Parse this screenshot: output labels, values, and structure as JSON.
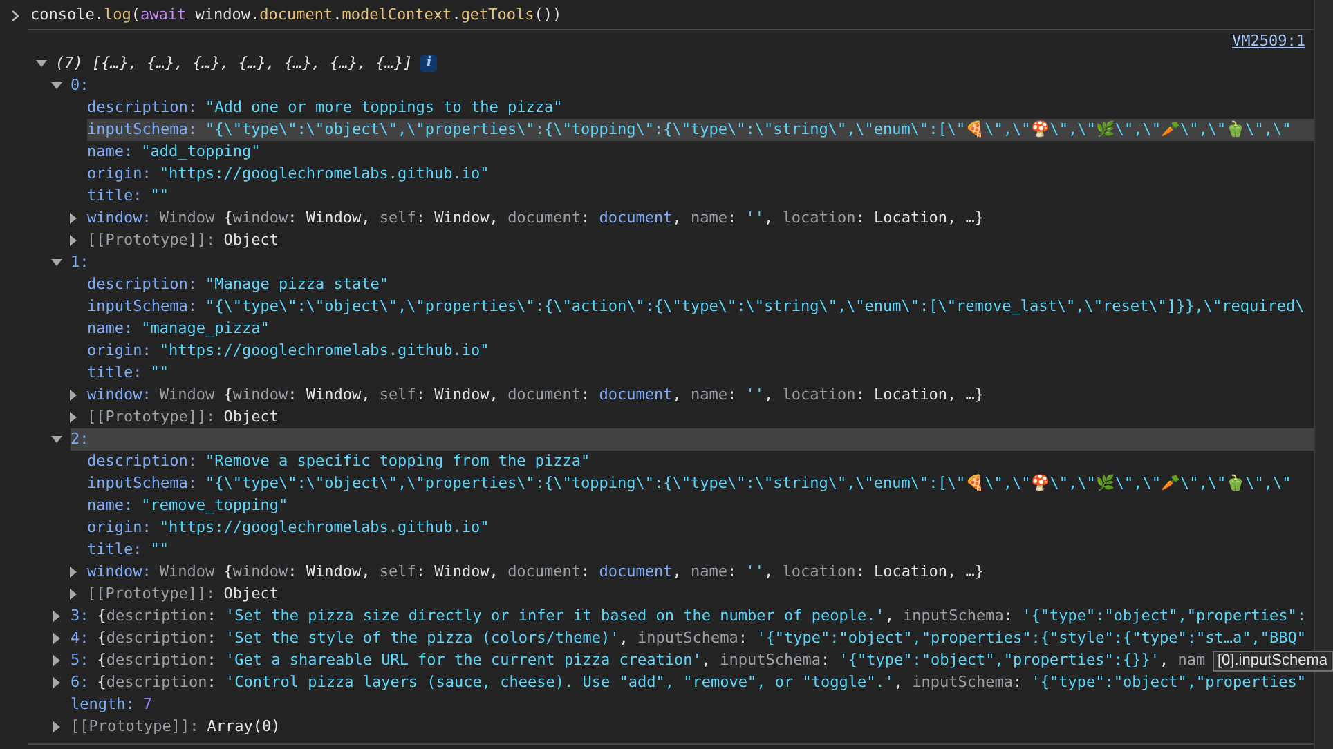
{
  "command": {
    "tokens": [
      {
        "text": "console.",
        "kind": "plain"
      },
      {
        "text": "log",
        "kind": "method"
      },
      {
        "text": "(",
        "kind": "plain"
      },
      {
        "text": "await",
        "kind": "keyword"
      },
      {
        "text": " window.",
        "kind": "plain"
      },
      {
        "text": "document",
        "kind": "method"
      },
      {
        "text": ".",
        "kind": "plain"
      },
      {
        "text": "modelContext",
        "kind": "method"
      },
      {
        "text": ".",
        "kind": "plain"
      },
      {
        "text": "getTools",
        "kind": "method"
      },
      {
        "text": "())",
        "kind": "plain"
      }
    ]
  },
  "source_link": "VM2509:1",
  "result": {
    "expanded": true,
    "summary": "(7) [{…}, {…}, {…}, {…}, {…}, {…}, {…}]",
    "info": "i",
    "items": [
      {
        "index": "0:",
        "expanded": true,
        "highlighted": false,
        "properties": [
          {
            "key": "description:",
            "highlighted": false,
            "tokens": [
              {
                "text": "\"Add one or more toppings to the pizza\"",
                "kind": "string"
              }
            ]
          },
          {
            "key": "inputSchema:",
            "highlighted": true,
            "tokens": [
              {
                "text": "\"{\\\"type\\\":\\\"object\\\",\\\"properties\\\":{\\\"topping\\\":{\\\"type\\\":\\\"string\\\",\\\"enum\\\":[\\\"🍕\\\",\\\"🍄\\\",\\\"🌿\\\",\\\"🥕\\\",\\\"🫑\\\",\\\"",
                "kind": "string"
              }
            ]
          },
          {
            "key": "name:",
            "highlighted": false,
            "tokens": [
              {
                "text": "\"add_topping\"",
                "kind": "string"
              }
            ]
          },
          {
            "key": "origin:",
            "highlighted": false,
            "tokens": [
              {
                "text": "\"https://googlechromelabs.github.io\"",
                "kind": "string"
              }
            ]
          },
          {
            "key": "title:",
            "highlighted": false,
            "tokens": [
              {
                "text": "\"\"",
                "kind": "string"
              }
            ]
          },
          {
            "key": "window:",
            "expanded": false,
            "highlighted": false,
            "tokens": [
              {
                "text": "Window ",
                "kind": "dim"
              },
              {
                "text": "{",
                "kind": "plain"
              },
              {
                "text": "window",
                "kind": "dim"
              },
              {
                "text": ": Window, ",
                "kind": "plain"
              },
              {
                "text": "self",
                "kind": "dim"
              },
              {
                "text": ": Window, ",
                "kind": "plain"
              },
              {
                "text": "document",
                "kind": "dim"
              },
              {
                "text": ": ",
                "kind": "plain"
              },
              {
                "text": "document",
                "kind": "object"
              },
              {
                "text": ", ",
                "kind": "plain"
              },
              {
                "text": "name",
                "kind": "dim"
              },
              {
                "text": ": ",
                "kind": "plain"
              },
              {
                "text": "''",
                "kind": "string"
              },
              {
                "text": ", ",
                "kind": "plain"
              },
              {
                "text": "location",
                "kind": "dim"
              },
              {
                "text": ": Location, …}",
                "kind": "plain"
              }
            ]
          }
        ],
        "prototype": {
          "key": "[[Prototype]]:",
          "value": "Object",
          "expanded": false
        }
      },
      {
        "index": "1:",
        "expanded": true,
        "highlighted": false,
        "properties": [
          {
            "key": "description:",
            "highlighted": false,
            "tokens": [
              {
                "text": "\"Manage pizza state\"",
                "kind": "string"
              }
            ]
          },
          {
            "key": "inputSchema:",
            "highlighted": false,
            "tokens": [
              {
                "text": "\"{\\\"type\\\":\\\"object\\\",\\\"properties\\\":{\\\"action\\\":{\\\"type\\\":\\\"string\\\",\\\"enum\\\":[\\\"remove_last\\\",\\\"reset\\\"]}},\\\"required\\",
                "kind": "string"
              }
            ]
          },
          {
            "key": "name:",
            "highlighted": false,
            "tokens": [
              {
                "text": "\"manage_pizza\"",
                "kind": "string"
              }
            ]
          },
          {
            "key": "origin:",
            "highlighted": false,
            "tokens": [
              {
                "text": "\"https://googlechromelabs.github.io\"",
                "kind": "string"
              }
            ]
          },
          {
            "key": "title:",
            "highlighted": false,
            "tokens": [
              {
                "text": "\"\"",
                "kind": "string"
              }
            ]
          },
          {
            "key": "window:",
            "expanded": false,
            "highlighted": false,
            "tokens": [
              {
                "text": "Window ",
                "kind": "dim"
              },
              {
                "text": "{",
                "kind": "plain"
              },
              {
                "text": "window",
                "kind": "dim"
              },
              {
                "text": ": Window, ",
                "kind": "plain"
              },
              {
                "text": "self",
                "kind": "dim"
              },
              {
                "text": ": Window, ",
                "kind": "plain"
              },
              {
                "text": "document",
                "kind": "dim"
              },
              {
                "text": ": ",
                "kind": "plain"
              },
              {
                "text": "document",
                "kind": "object"
              },
              {
                "text": ", ",
                "kind": "plain"
              },
              {
                "text": "name",
                "kind": "dim"
              },
              {
                "text": ": ",
                "kind": "plain"
              },
              {
                "text": "''",
                "kind": "string"
              },
              {
                "text": ", ",
                "kind": "plain"
              },
              {
                "text": "location",
                "kind": "dim"
              },
              {
                "text": ": Location, …}",
                "kind": "plain"
              }
            ]
          }
        ],
        "prototype": {
          "key": "[[Prototype]]:",
          "value": "Object",
          "expanded": false
        }
      },
      {
        "index": "2:",
        "expanded": true,
        "highlighted": true,
        "properties": [
          {
            "key": "description:",
            "highlighted": false,
            "tokens": [
              {
                "text": "\"Remove a specific topping from the pizza\"",
                "kind": "string"
              }
            ]
          },
          {
            "key": "inputSchema:",
            "highlighted": false,
            "tokens": [
              {
                "text": "\"{\\\"type\\\":\\\"object\\\",\\\"properties\\\":{\\\"topping\\\":{\\\"type\\\":\\\"string\\\",\\\"enum\\\":[\\\"🍕\\\",\\\"🍄\\\",\\\"🌿\\\",\\\"🥕\\\",\\\"🫑\\\",\\\"",
                "kind": "string"
              }
            ]
          },
          {
            "key": "name:",
            "highlighted": false,
            "tokens": [
              {
                "text": "\"remove_topping\"",
                "kind": "string"
              }
            ]
          },
          {
            "key": "origin:",
            "highlighted": false,
            "tokens": [
              {
                "text": "\"https://googlechromelabs.github.io\"",
                "kind": "string"
              }
            ]
          },
          {
            "key": "title:",
            "highlighted": false,
            "tokens": [
              {
                "text": "\"\"",
                "kind": "string"
              }
            ]
          },
          {
            "key": "window:",
            "expanded": false,
            "highlighted": false,
            "tokens": [
              {
                "text": "Window ",
                "kind": "dim"
              },
              {
                "text": "{",
                "kind": "plain"
              },
              {
                "text": "window",
                "kind": "dim"
              },
              {
                "text": ": Window, ",
                "kind": "plain"
              },
              {
                "text": "self",
                "kind": "dim"
              },
              {
                "text": ": Window, ",
                "kind": "plain"
              },
              {
                "text": "document",
                "kind": "dim"
              },
              {
                "text": ": ",
                "kind": "plain"
              },
              {
                "text": "document",
                "kind": "object"
              },
              {
                "text": ", ",
                "kind": "plain"
              },
              {
                "text": "name",
                "kind": "dim"
              },
              {
                "text": ": ",
                "kind": "plain"
              },
              {
                "text": "''",
                "kind": "string"
              },
              {
                "text": ", ",
                "kind": "plain"
              },
              {
                "text": "location",
                "kind": "dim"
              },
              {
                "text": ": Location, …}",
                "kind": "plain"
              }
            ]
          }
        ],
        "prototype": {
          "key": "[[Prototype]]:",
          "value": "Object",
          "expanded": false
        }
      },
      {
        "index": "3:",
        "expanded": false,
        "highlighted": false,
        "preview": [
          {
            "text": "{",
            "kind": "plain"
          },
          {
            "text": "description",
            "kind": "dim"
          },
          {
            "text": ": ",
            "kind": "plain"
          },
          {
            "text": "'Set the pizza size directly or infer it based on the number of people.'",
            "kind": "string"
          },
          {
            "text": ", ",
            "kind": "plain"
          },
          {
            "text": "inputSchema",
            "kind": "dim"
          },
          {
            "text": ": ",
            "kind": "plain"
          },
          {
            "text": "'{\"type\":\"object\",\"properties\":",
            "kind": "string"
          }
        ]
      },
      {
        "index": "4:",
        "expanded": false,
        "highlighted": false,
        "preview": [
          {
            "text": "{",
            "kind": "plain"
          },
          {
            "text": "description",
            "kind": "dim"
          },
          {
            "text": ": ",
            "kind": "plain"
          },
          {
            "text": "'Set the style of the pizza (colors/theme)'",
            "kind": "string"
          },
          {
            "text": ", ",
            "kind": "plain"
          },
          {
            "text": "inputSchema",
            "kind": "dim"
          },
          {
            "text": ": ",
            "kind": "plain"
          },
          {
            "text": "'{\"type\":\"object\",\"properties\":{\"style\":{\"type\":\"st…a\",\"BBQ\"",
            "kind": "string"
          }
        ]
      },
      {
        "index": "5:",
        "expanded": false,
        "highlighted": false,
        "preview": [
          {
            "text": "{",
            "kind": "plain"
          },
          {
            "text": "description",
            "kind": "dim"
          },
          {
            "text": ": ",
            "kind": "plain"
          },
          {
            "text": "'Get a shareable URL for the current pizza creation'",
            "kind": "string"
          },
          {
            "text": ", ",
            "kind": "plain"
          },
          {
            "text": "inputSchema",
            "kind": "dim"
          },
          {
            "text": ": ",
            "kind": "plain"
          },
          {
            "text": "'{\"type\":\"object\",\"properties\":{}}'",
            "kind": "string"
          },
          {
            "text": ", ",
            "kind": "plain"
          },
          {
            "text": "nam",
            "kind": "dim"
          }
        ]
      },
      {
        "index": "6:",
        "expanded": false,
        "highlighted": false,
        "preview": [
          {
            "text": "{",
            "kind": "plain"
          },
          {
            "text": "description",
            "kind": "dim"
          },
          {
            "text": ": ",
            "kind": "plain"
          },
          {
            "text": "'Control pizza layers (sauce, cheese). Use \"add\", \"remove\", or \"toggle\".'",
            "kind": "string"
          },
          {
            "text": ", ",
            "kind": "plain"
          },
          {
            "text": "inputSchema",
            "kind": "dim"
          },
          {
            "text": ": ",
            "kind": "plain"
          },
          {
            "text": "'{\"type\":\"object\",\"properties\"",
            "kind": "string"
          }
        ]
      }
    ],
    "length": {
      "key": "length:",
      "value": "7"
    },
    "prototype": {
      "key": "[[Prototype]]:",
      "value": "Array(0)",
      "expanded": false
    }
  },
  "tooltip": "[0].inputSchema"
}
